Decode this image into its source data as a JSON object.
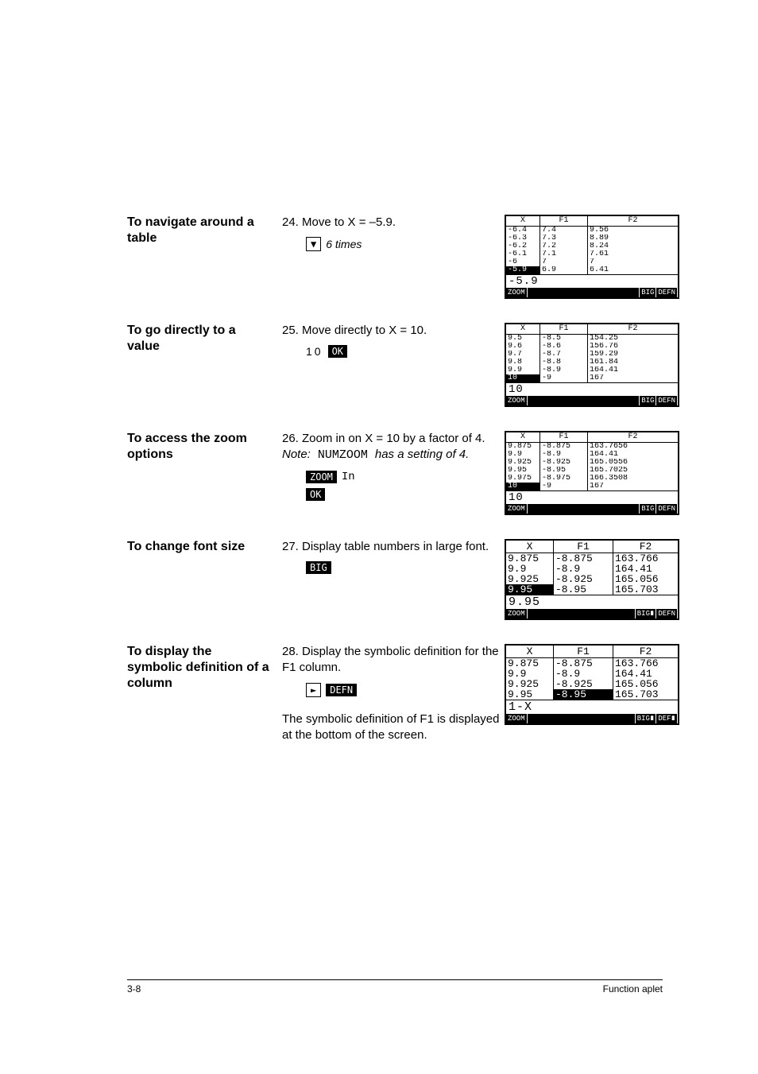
{
  "sections": [
    {
      "side": "To navigate around a table",
      "instr": "24. Move to X = –5.9.",
      "keyhint": "6 times",
      "screen": {
        "headers": [
          "X",
          "F1",
          "F2"
        ],
        "rows": [
          [
            "-6.4",
            "7.4",
            "9.56"
          ],
          [
            "-6.3",
            "7.3",
            "8.89"
          ],
          [
            "-6.2",
            "7.2",
            "8.24"
          ],
          [
            "-6.1",
            "7.1",
            "7.61"
          ],
          [
            "-6",
            "7",
            "7"
          ],
          [
            "-5.9",
            "6.9",
            "6.41"
          ]
        ],
        "selectedRow": 5,
        "selCols": [
          0
        ],
        "entry": "-5.9",
        "menu": [
          "ZOOM",
          "",
          "",
          "",
          "BIG",
          "DEFN"
        ]
      }
    },
    {
      "side": "To go directly to a value",
      "instr": "25. Move directly to X = 10.",
      "keyhint2": "10",
      "keyButton": "OK",
      "screen": {
        "headers": [
          "X",
          "F1",
          "F2"
        ],
        "rows": [
          [
            "9.5",
            "-8.5",
            "154.25"
          ],
          [
            "9.6",
            "-8.6",
            "156.76"
          ],
          [
            "9.7",
            "-8.7",
            "159.29"
          ],
          [
            "9.8",
            "-8.8",
            "161.84"
          ],
          [
            "9.9",
            "-8.9",
            "164.41"
          ],
          [
            "10",
            "-9",
            "167"
          ]
        ],
        "selectedRow": 5,
        "selCols": [
          0
        ],
        "entry": "10",
        "menu": [
          "ZOOM",
          "",
          "",
          "",
          "BIG",
          "DEFN"
        ]
      }
    },
    {
      "side": "To access the zoom options",
      "instrParts": [
        "26. Zoom in on X = 10 by a factor of 4. ",
        "Note:",
        " NUMZOOM ",
        "has a setting of 4."
      ],
      "keyButtons": [
        "ZOOM",
        "In",
        "OK"
      ],
      "screen": {
        "headers": [
          "X",
          "F1",
          "F2"
        ],
        "rows": [
          [
            "9.875",
            "-8.875",
            "163.7656"
          ],
          [
            "9.9",
            "-8.9",
            "164.41"
          ],
          [
            "9.925",
            "-8.925",
            "165.0556"
          ],
          [
            "9.95",
            "-8.95",
            "165.7025"
          ],
          [
            "9.975",
            "-8.975",
            "166.3508"
          ],
          [
            "10",
            "-9",
            "167"
          ]
        ],
        "selectedRow": 5,
        "selCols": [
          0
        ],
        "entry": "10",
        "menu": [
          "ZOOM",
          "",
          "",
          "",
          "BIG",
          "DEFN"
        ]
      }
    },
    {
      "side": "To change font size",
      "instr": "27. Display table numbers in large font.",
      "keyButton": "BIG",
      "big": true,
      "screen": {
        "headers": [
          "X",
          "F1",
          "F2"
        ],
        "rows": [
          [
            "9.875",
            "-8.875",
            "163.766"
          ],
          [
            "9.9",
            "-8.9",
            "164.41"
          ],
          [
            "9.925",
            "-8.925",
            "165.056"
          ],
          [
            "9.95",
            "-8.95",
            "165.703"
          ]
        ],
        "selectedRow": 3,
        "selCols": [
          0
        ],
        "entry": "9.95",
        "menu": [
          "ZOOM",
          "",
          "",
          "",
          "BIG∎",
          "DEFN"
        ]
      }
    },
    {
      "side": "To display the symbolic definition of a column",
      "instr": "28. Display the symbolic definition for the F1 column.",
      "keyhint3": "DEFN",
      "aftertext": "The symbolic definition of F1 is displayed at the bottom of the screen.",
      "big": true,
      "screen": {
        "headers": [
          "X",
          "F1",
          "F2"
        ],
        "rows": [
          [
            "9.875",
            "-8.875",
            "163.766"
          ],
          [
            "9.9",
            "-8.9",
            "164.41"
          ],
          [
            "9.925",
            "-8.925",
            "165.056"
          ],
          [
            "9.95",
            "-8.95",
            "165.703"
          ]
        ],
        "selectedRow": 3,
        "selCols": [
          1
        ],
        "entry": "1-X",
        "menu": [
          "ZOOM",
          "",
          "",
          "",
          "BIG∎",
          "DEF∎"
        ]
      }
    }
  ],
  "footer": {
    "left": "3-8",
    "right": "Function aplet"
  }
}
